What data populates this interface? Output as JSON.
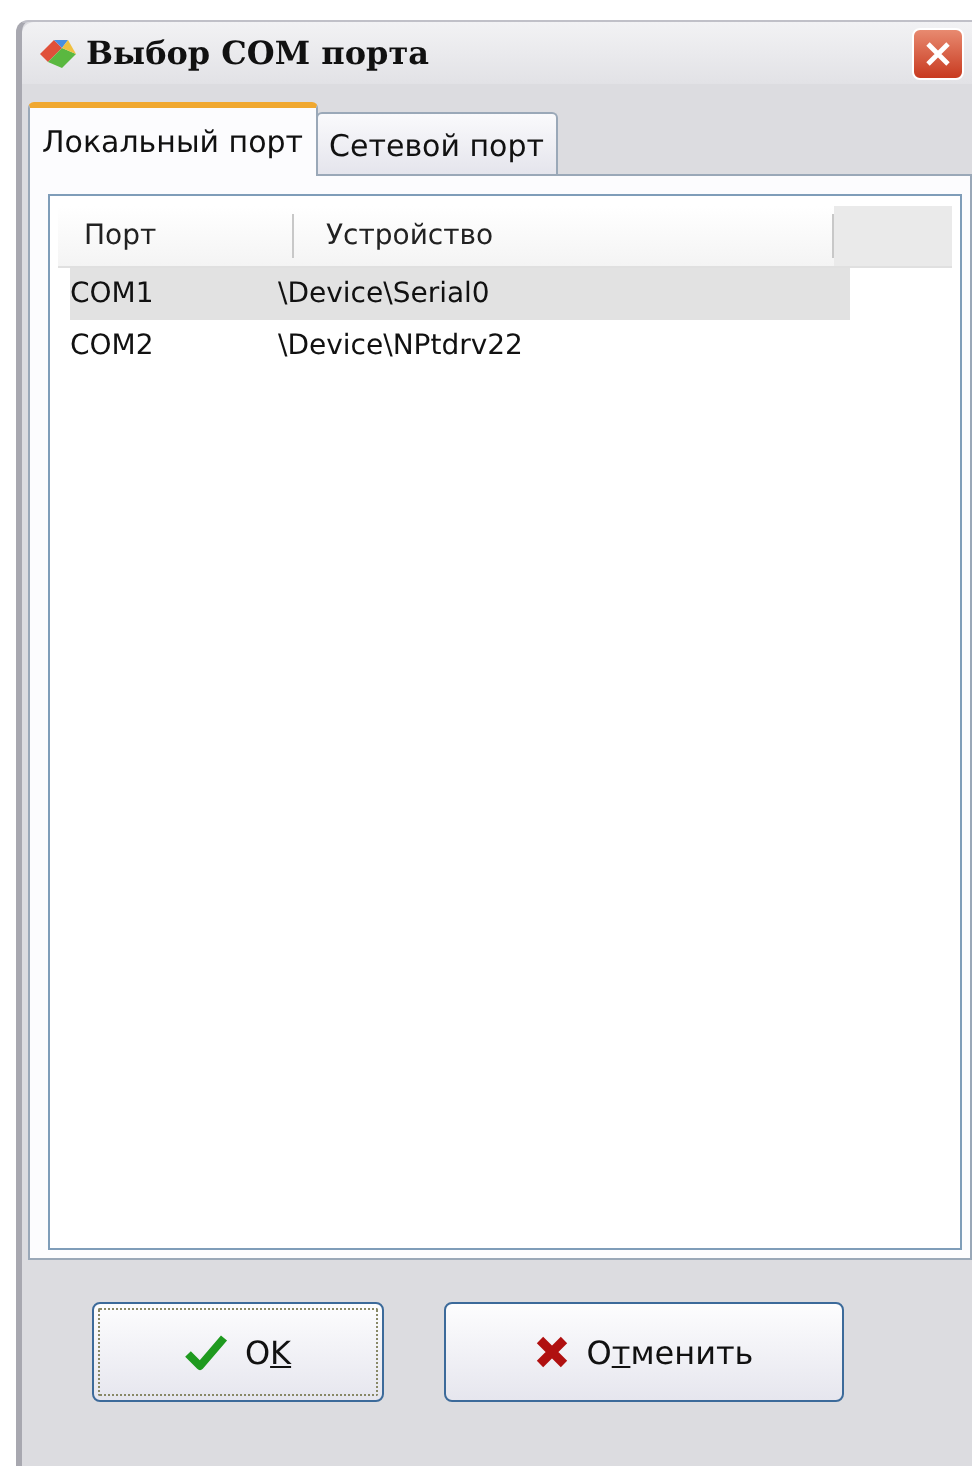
{
  "window": {
    "title": "Выбор COM порта"
  },
  "tabs": [
    {
      "label": "Локальный порт",
      "selected": true
    },
    {
      "label": "Сетевой порт",
      "selected": false
    }
  ],
  "table": {
    "columns": [
      "Порт",
      "Устройство"
    ],
    "rows": [
      {
        "cells": [
          "COM1",
          "\\Device\\Serial0"
        ],
        "selected": true
      },
      {
        "cells": [
          "COM2",
          "\\Device\\NPtdrv22"
        ],
        "selected": false
      }
    ]
  },
  "buttons": [
    {
      "kind": "ok",
      "before": "O",
      "accel": "K",
      "focused": true
    },
    {
      "kind": "cancel",
      "before": "О",
      "accel": "т",
      "after": "менить",
      "focused": false
    }
  ]
}
